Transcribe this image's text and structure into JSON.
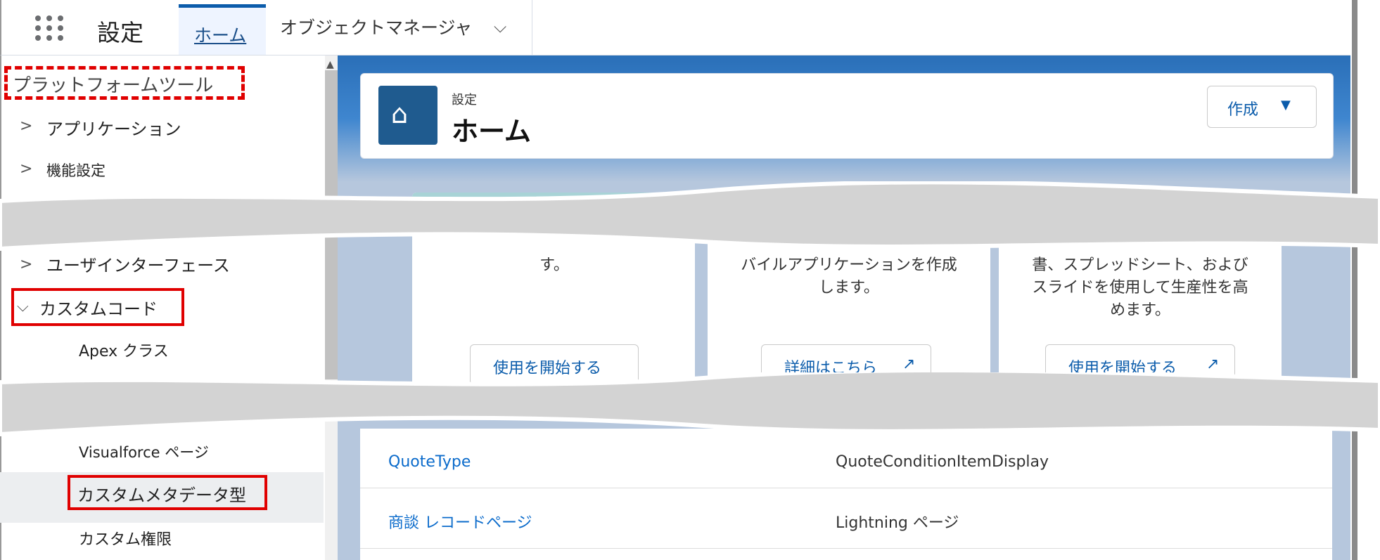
{
  "app": {
    "title": "設定"
  },
  "tabs": [
    {
      "label": "ホーム"
    },
    {
      "label": "オブジェクトマネージャ"
    }
  ],
  "sidebar": {
    "section_title": "プラットフォームツール",
    "items": [
      {
        "label": "アプリケーション"
      },
      {
        "label": "機能設定"
      },
      {
        "label": "ユーザインターフェース"
      },
      {
        "label": "カスタムコード"
      },
      {
        "label": "Apex クラス"
      },
      {
        "label": "Visualforce ページ"
      },
      {
        "label": "カスタムメタデータ型"
      },
      {
        "label": "カスタム権限"
      }
    ]
  },
  "header": {
    "subtitle": "設定",
    "title": "ホーム",
    "create_label": "作成"
  },
  "cards": [
    {
      "text_lines": [
        "す。"
      ],
      "button": "使用を開始する"
    },
    {
      "text_lines": [
        "バイルアプリケーションを作成",
        "します。"
      ],
      "button": "詳細はこちら"
    },
    {
      "text_lines": [
        "書、スプレッドシート、および",
        "スライドを使用して生産性を高",
        "めます。"
      ],
      "button": "使用を開始する"
    }
  ],
  "list": {
    "rows": [
      {
        "name": "QuoteType",
        "value": "QuoteConditionItemDisplay"
      },
      {
        "name": "商談 レコードページ",
        "value": "Lightning ページ"
      }
    ]
  },
  "colors": {
    "accent": "#0b5cab",
    "highlight": "#e00000",
    "tear": "#d3d3d3"
  }
}
